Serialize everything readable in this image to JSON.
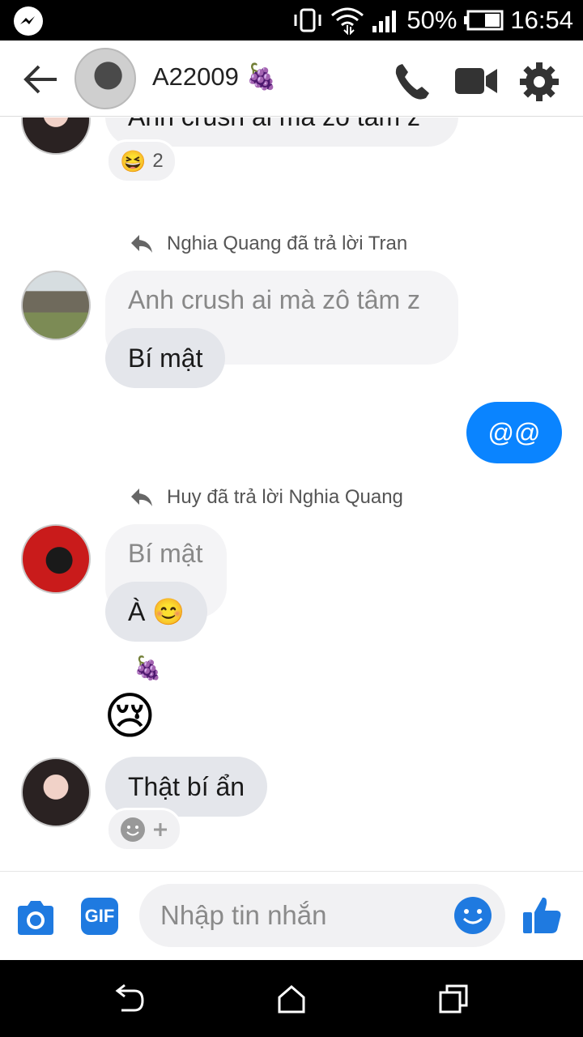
{
  "status_bar": {
    "battery": "50%",
    "time": "16:54"
  },
  "header": {
    "title": "A22009 🍇"
  },
  "messages": {
    "top_partial_text": "Anh crush ai mà zô tâm z",
    "top_reaction_emoji": "😆",
    "top_reaction_count": "2",
    "reply1_label": "Nghia Quang đã trả lời Tran",
    "reply1_quoted": "Anh crush ai mà zô tâm z",
    "reply1_text": "Bí mật",
    "sent_text": "@@",
    "reply2_label": "Huy đã trả lời Nghia Quang",
    "reply2_quoted": "Bí mật",
    "reply2_text": "À 😊",
    "grape_emoji": "🍇",
    "sad_emoji": "😢",
    "last_text": "Thật bí ẩn"
  },
  "composer": {
    "gif_label": "GIF",
    "placeholder": "Nhập tin nhắn"
  },
  "colors": {
    "accent": "#0a84ff",
    "bubble_gray": "#f1f1f3"
  }
}
